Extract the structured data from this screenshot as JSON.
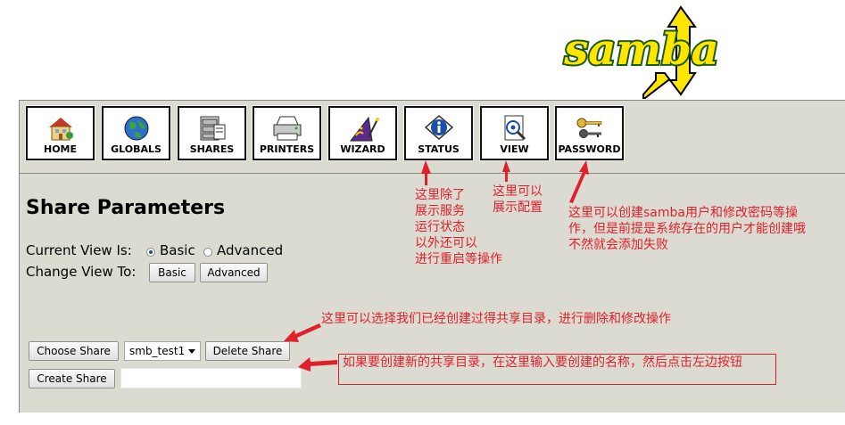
{
  "logo": {
    "text": "samba"
  },
  "nav": [
    {
      "label": "HOME",
      "icon": "home-icon"
    },
    {
      "label": "GLOBALS",
      "icon": "globe-icon"
    },
    {
      "label": "SHARES",
      "icon": "shares-icon"
    },
    {
      "label": "PRINTERS",
      "icon": "printer-icon"
    },
    {
      "label": "WIZARD",
      "icon": "wizard-icon"
    },
    {
      "label": "STATUS",
      "icon": "status-icon"
    },
    {
      "label": "VIEW",
      "icon": "view-icon"
    },
    {
      "label": "PASSWORD",
      "icon": "keys-icon"
    }
  ],
  "page": {
    "title": "Share Parameters",
    "current_view_label": "Current View Is:",
    "view_basic": "Basic",
    "view_advanced": "Advanced",
    "current_view_selected": "Basic",
    "change_view_label": "Change View To:",
    "basic_button": "Basic",
    "advanced_button": "Advanced"
  },
  "share": {
    "choose_button": "Choose Share",
    "selected_share": "smb_test1",
    "delete_button": "Delete Share",
    "create_button": "Create Share",
    "new_share_value": ""
  },
  "annotations": {
    "status_note": "这里除了\n展示服务\n运行状态\n以外还可以\n进行重启等操作",
    "view_note": "这里可以\n展示配置",
    "password_note": "这里可以创建samba用户和修改密码等操\n作，但是前提是系统存在的用户才能创建哦\n不然就会添加失败",
    "choose_note": "这里可以选择我们已经创建过得共享目录，进行删除和修改操作",
    "create_note": "如果要创建新的共享目录，在这里输入要创建的名称，然后点击左边按钮"
  },
  "colors": {
    "panel_bg": "#dbdbd2",
    "annotation_red": "#e0202a",
    "logo_fill": "#ffe600",
    "logo_outline": "#1a5a1a"
  }
}
